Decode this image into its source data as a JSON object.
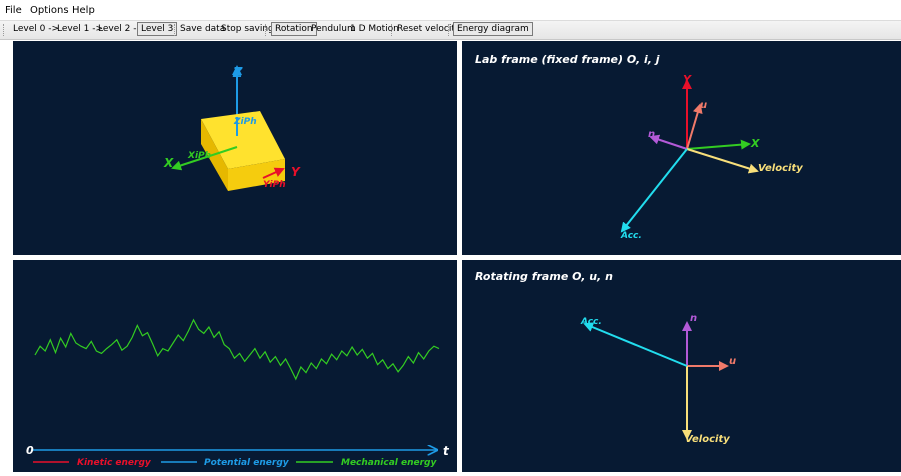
{
  "menu": {
    "file": "File",
    "options": "Options",
    "help": "Help"
  },
  "toolbar": {
    "level0": "Level 0 ->",
    "level1": "Level 1 ->",
    "level2": "Level 2 ->",
    "level3": "Level 3",
    "save_data": "Save data",
    "stop_saving": "Stop saving",
    "rotation": "Rotation",
    "pendulum": "Pendulum",
    "motion_1d": "1 D Motion",
    "reset_velocity": "Reset velocity",
    "energy_diagram": "Energy diagram"
  },
  "view3d": {
    "z": "Z",
    "x": "X",
    "y": "Y",
    "zph": "ZiPh",
    "xph": "XiPh",
    "yph": "YiPh"
  },
  "lab": {
    "title": "Lab frame (fixed frame) O, i, j",
    "y": "Y",
    "x": "X",
    "u": "u",
    "n": "n",
    "velocity": "Velocity",
    "acc": "Acc."
  },
  "rot": {
    "title": "Rotating frame O, u, n",
    "n": "n",
    "u": "u",
    "velocity": "Velocity",
    "acc": "Acc."
  },
  "energy": {
    "origin": "0",
    "time_label": "t",
    "legend": {
      "kinetic": "Kinetic energy",
      "potential": "Potential energy",
      "mechanical": "Mechanical energy"
    },
    "colors": {
      "kinetic": "#e8102a",
      "potential": "#1e9be6",
      "mechanical": "#33cc22"
    }
  },
  "chart_data": {
    "type": "line",
    "series": [
      {
        "name": "Mechanical energy",
        "values": [
          0.25,
          0.36,
          0.3,
          0.44,
          0.28,
          0.46,
          0.35,
          0.52,
          0.4,
          0.36,
          0.33,
          0.42,
          0.3,
          0.27,
          0.33,
          0.38,
          0.44,
          0.31,
          0.36,
          0.47,
          0.62,
          0.49,
          0.53,
          0.39,
          0.24,
          0.33,
          0.3,
          0.4,
          0.5,
          0.43,
          0.55,
          0.69,
          0.57,
          0.52,
          0.6,
          0.47,
          0.54,
          0.38,
          0.33,
          0.21,
          0.27,
          0.17,
          0.25,
          0.33,
          0.21,
          0.29,
          0.16,
          0.23,
          0.12,
          0.2,
          0.08,
          -0.05,
          0.1,
          0.03,
          0.15,
          0.08,
          0.2,
          0.14,
          0.26,
          0.19,
          0.3,
          0.24,
          0.35,
          0.25,
          0.32,
          0.21,
          0.27,
          0.13,
          0.19,
          0.08,
          0.14,
          0.04,
          0.12,
          0.23,
          0.15,
          0.28,
          0.2,
          0.3,
          0.36,
          0.33
        ]
      }
    ]
  }
}
